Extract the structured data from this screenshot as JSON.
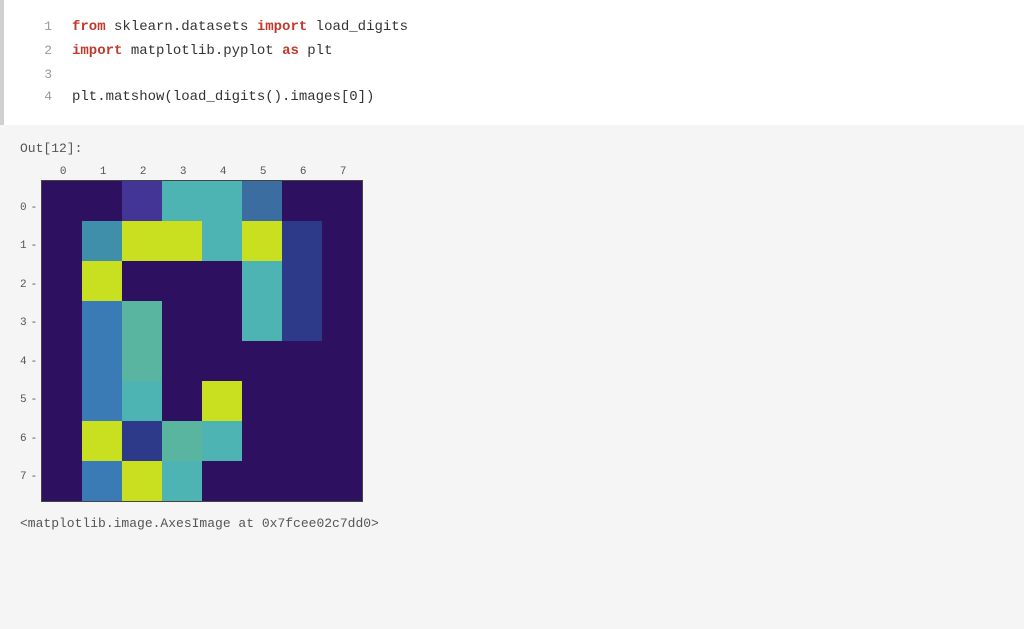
{
  "code": {
    "lines": [
      {
        "num": "1",
        "parts": [
          {
            "text": "from",
            "class": "kw-from"
          },
          {
            "text": " sklearn.datasets ",
            "class": "normal"
          },
          {
            "text": "import",
            "class": "kw-import"
          },
          {
            "text": " load_digits",
            "class": "normal"
          }
        ]
      },
      {
        "num": "2",
        "parts": [
          {
            "text": "import",
            "class": "kw-import"
          },
          {
            "text": " matplotlib.pyplot ",
            "class": "normal"
          },
          {
            "text": "as",
            "class": "kw-as"
          },
          {
            "text": " plt",
            "class": "normal"
          }
        ]
      },
      {
        "num": "3",
        "parts": []
      },
      {
        "num": "4",
        "parts": [
          {
            "text": "plt.matshow(load_digits().images[0])",
            "class": "normal"
          }
        ]
      }
    ]
  },
  "output_label": "Out[12]:",
  "x_labels": [
    "0",
    "1",
    "2",
    "3",
    "4",
    "5",
    "6",
    "7"
  ],
  "y_labels": [
    "0",
    "1",
    "2",
    "3",
    "4",
    "5",
    "6",
    "7"
  ],
  "result_text": "<matplotlib.image.AxesImage at 0x7fcee02c7dd0>",
  "grid": [
    [
      "#2d1160",
      "#2d1160",
      "#433595",
      "#4eb3b3",
      "#4eb3b3",
      "#3b6da0",
      "#2d1160",
      "#2d1160"
    ],
    [
      "#2d1160",
      "#3f8faa",
      "#c8e020",
      "#c8e020",
      "#4eb3b3",
      "#c8e020",
      "#2d3a8a",
      "#2d1160"
    ],
    [
      "#2d1160",
      "#c8e020",
      "#2d1160",
      "#2d1160",
      "#2d1160",
      "#4eb3b3",
      "#2d3a8a",
      "#2d1160"
    ],
    [
      "#2d1160",
      "#3a7ab5",
      "#5ab5a0",
      "#2d1160",
      "#2d1160",
      "#4eb3b3",
      "#2d3a8a",
      "#2d1160"
    ],
    [
      "#2d1160",
      "#3a7ab5",
      "#5ab5a0",
      "#2d1160",
      "#2d1160",
      "#2d1160",
      "#2d1160",
      "#2d1160"
    ],
    [
      "#2d1160",
      "#3a7ab5",
      "#4eb3b3",
      "#2d1160",
      "#c8e020",
      "#2d1160",
      "#2d1160",
      "#2d1160"
    ],
    [
      "#2d1160",
      "#c8e020",
      "#2d3a8a",
      "#5ab5a0",
      "#4eb3b3",
      "#2d1160",
      "#2d1160",
      "#2d1160"
    ],
    [
      "#2d1160",
      "#3a7ab5",
      "#c8e020",
      "#4eb3b3",
      "#2d1160",
      "#2d1160",
      "#2d1160",
      "#2d1160"
    ]
  ]
}
